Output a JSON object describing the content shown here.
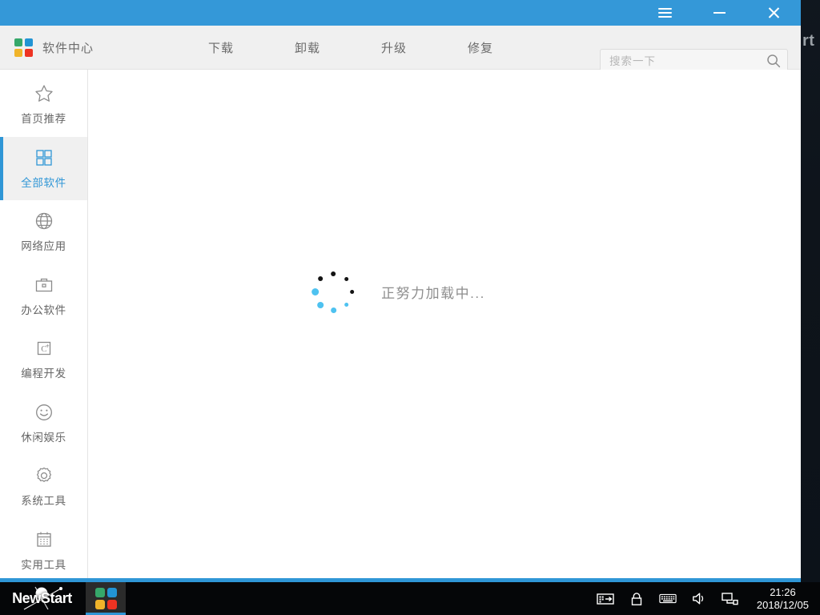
{
  "desktop": {
    "background_color": "#111821",
    "clipped_text": "rt"
  },
  "window": {
    "titlebar": {
      "color": "#3498d8",
      "buttons": [
        {
          "name": "menu-button",
          "icon": "hamburger-icon",
          "label": "☰"
        },
        {
          "name": "minimize-button",
          "icon": "minimize-icon",
          "label": "─"
        },
        {
          "name": "close-button",
          "icon": "close-icon",
          "label": "✕"
        }
      ]
    },
    "header": {
      "brand_title": "软件中心",
      "logo_colors": [
        "#36a86a",
        "#2294d4",
        "#f0b42a",
        "#ee3322"
      ],
      "nav": [
        {
          "label": "下载"
        },
        {
          "label": "卸载"
        },
        {
          "label": "升级"
        },
        {
          "label": "修复"
        }
      ],
      "search": {
        "placeholder": "搜索一下",
        "value": "",
        "icon": "search-icon"
      }
    },
    "sidebar": {
      "items": [
        {
          "label": "首页推荐",
          "icon": "star-icon",
          "active": false
        },
        {
          "label": "全部软件",
          "icon": "grid-icon",
          "active": true
        },
        {
          "label": "网络应用",
          "icon": "globe-icon",
          "active": false
        },
        {
          "label": "办公软件",
          "icon": "briefcase-icon",
          "active": false
        },
        {
          "label": "编程开发",
          "icon": "c-plus-icon",
          "active": false
        },
        {
          "label": "休闲娱乐",
          "icon": "smiley-icon",
          "active": false
        },
        {
          "label": "系统工具",
          "icon": "gear-icon",
          "active": false
        },
        {
          "label": "实用工具",
          "icon": "calendar-icon",
          "active": false
        }
      ],
      "active_color": "#2f96d6"
    },
    "content": {
      "loading_text": "正努力加载中...",
      "spinner": {
        "dark_color": "#141414",
        "accent_color": "#4ec2f0",
        "dots": [
          {
            "angle": 270,
            "size": 6,
            "color": "#141414"
          },
          {
            "angle": 315,
            "size": 5.5,
            "color": "#141414"
          },
          {
            "angle": 0,
            "size": 5,
            "color": "#141414"
          },
          {
            "angle": 45,
            "size": 5,
            "color": "#4ec2f0"
          },
          {
            "angle": 90,
            "size": 7,
            "color": "#4ec2f0"
          },
          {
            "angle": 135,
            "size": 8,
            "color": "#4ec2f0"
          },
          {
            "angle": 180,
            "size": 9,
            "color": "#4ec2f0"
          },
          {
            "angle": 225,
            "size": 6,
            "color": "#141414"
          }
        ]
      }
    },
    "accent_color": "#2f96d6"
  },
  "taskbar": {
    "start_label": "NewStart",
    "app_button": {
      "name": "software-center-task-button",
      "active": true,
      "logo_colors": [
        "#36a86a",
        "#2294d4",
        "#f0b42a",
        "#ee3322"
      ]
    },
    "tray": [
      {
        "name": "input-method-icon"
      },
      {
        "name": "lock-icon"
      },
      {
        "name": "keyboard-icon"
      },
      {
        "name": "volume-icon"
      },
      {
        "name": "network-icon"
      }
    ],
    "clock": {
      "time": "21:26",
      "date": "2018/12/05"
    }
  }
}
